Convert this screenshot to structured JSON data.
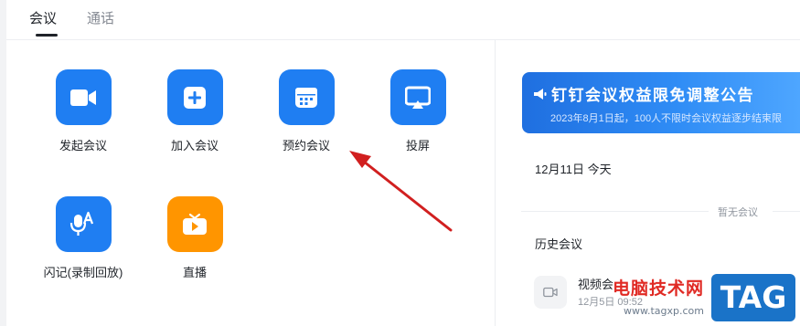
{
  "tabs": [
    {
      "label": "会议"
    },
    {
      "label": "通话"
    }
  ],
  "features": [
    {
      "label": "发起会议",
      "icon": "video-camera-icon",
      "color": "#1f7ef2"
    },
    {
      "label": "加入会议",
      "icon": "plus-square-icon",
      "color": "#1f7ef2"
    },
    {
      "label": "预约会议",
      "icon": "calendar-icon",
      "color": "#1f7ef2"
    },
    {
      "label": "投屏",
      "icon": "screen-cast-icon",
      "color": "#1f7ef2"
    },
    {
      "label": "闪记(录制回放)",
      "icon": "voice-record-icon",
      "color": "#1f7ef2"
    },
    {
      "label": "直播",
      "icon": "live-tv-icon",
      "color": "#ff9500"
    }
  ],
  "banner": {
    "title": "钉钉会议权益限免调整公告",
    "subtitle": "2023年8月1日起，100人不限时会议权益逐步结束限",
    "icon": "megaphone-icon"
  },
  "today": {
    "label": "12月11日 今天"
  },
  "empty": {
    "label": "暂无会议"
  },
  "history": {
    "title": "历史会议",
    "items": [
      {
        "title": "视频会",
        "time": "12月5日 09:52",
        "icon": "video-camera-icon"
      }
    ]
  },
  "watermark": {
    "text": "电脑技术网",
    "url": "www.tagxp.com",
    "tag": "TAG"
  },
  "colors": {
    "accent": "#1f7ef2",
    "live": "#ff9500",
    "arrow": "#d11f1f"
  }
}
